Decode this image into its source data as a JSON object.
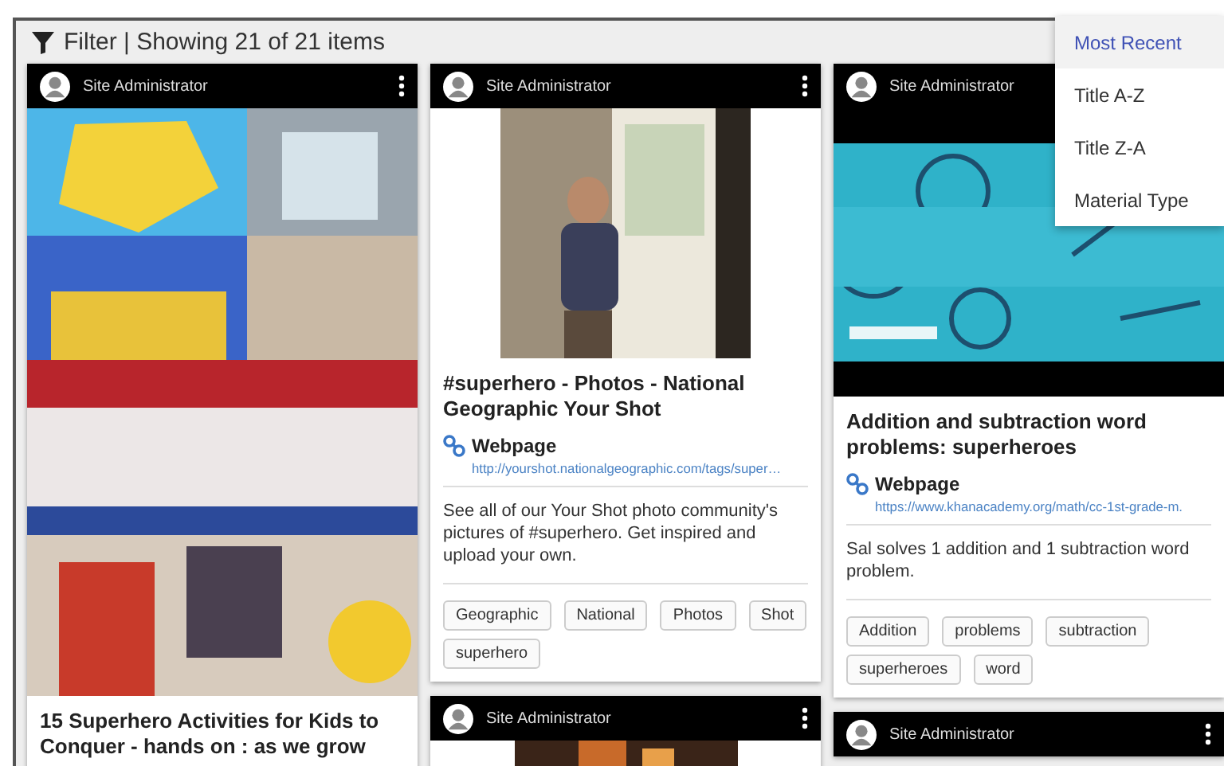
{
  "toolbar": {
    "summary": "Filter | Showing 21 of 21 items"
  },
  "sort_menu": [
    {
      "label": "Most Recent",
      "selected": true
    },
    {
      "label": "Title A-Z",
      "selected": false
    },
    {
      "label": "Title Z-A",
      "selected": false
    },
    {
      "label": "Material Type",
      "selected": false
    }
  ],
  "columns": [
    {
      "cards": [
        {
          "author": "Site Administrator",
          "title": "15 Superhero Activities for Kids to Conquer - hands on : as we grow"
        }
      ]
    },
    {
      "cards": [
        {
          "author": "Site Administrator",
          "title": "#superhero - Photos - National Geographic Your Shot",
          "link": {
            "type": "Webpage",
            "url": "http://yourshot.nationalgeographic.com/tags/super…"
          },
          "description": "See all of our Your Shot photo community's pictures of #superhero. Get inspired and upload your own.",
          "tags": [
            "Geographic",
            "National",
            "Photos",
            "Shot",
            "superhero"
          ]
        },
        {
          "author": "Site Administrator"
        }
      ]
    },
    {
      "cards": [
        {
          "author": "Site Administrator",
          "title": "Addition and subtraction word problems: superheroes",
          "link": {
            "type": "Webpage",
            "url": "https://www.khanacademy.org/math/cc-1st-grade-m."
          },
          "description": "Sal solves 1 addition and 1 subtraction word problem.",
          "tags": [
            "Addition",
            "problems",
            "subtraction",
            "superheroes",
            "word"
          ]
        },
        {
          "author": "Site Administrator"
        }
      ]
    }
  ]
}
